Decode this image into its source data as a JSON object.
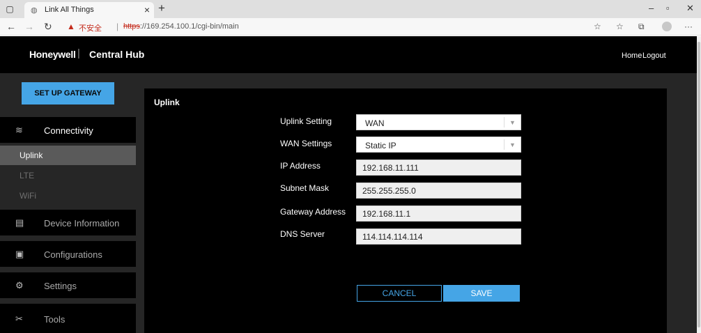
{
  "browser": {
    "tab_title": "Link All Things",
    "new_tab": "+",
    "not_secure": "不安全",
    "url_scheme": "https",
    "url_rest": "://169.254.100.1/cgi-bin/main"
  },
  "header": {
    "brand": "Honeywell",
    "separator": "|",
    "product": "Central Hub",
    "home": "Home",
    "logout": "Logout"
  },
  "sidebar": {
    "setup_button": "SET UP GATEWAY",
    "connectivity": "Connectivity",
    "sub_items": [
      "Uplink",
      "LTE",
      "WiFi"
    ],
    "device_information": "Device Information",
    "configurations": "Configurations",
    "settings": "Settings",
    "tools": "Tools"
  },
  "main": {
    "title": "Uplink",
    "fields": {
      "uplink_setting": {
        "label": "Uplink Setting",
        "value": "WAN"
      },
      "wan_settings": {
        "label": "WAN Settings",
        "value": "Static IP"
      },
      "ip_address": {
        "label": "IP Address",
        "value": "192.168.11.111"
      },
      "subnet_mask": {
        "label": "Subnet Mask",
        "value": "255.255.255.0"
      },
      "gateway_address": {
        "label": "Gateway Address",
        "value": "192.168.11.1"
      },
      "dns_server": {
        "label": "DNS Server",
        "value": "114.114.114.114"
      }
    },
    "cancel": "CANCEL",
    "save": "SAVE"
  },
  "colors": {
    "accent": "#45a5e6",
    "selected_item": "#5a5a5a",
    "page_bg": "#262626",
    "panel_bg": "#000000"
  }
}
